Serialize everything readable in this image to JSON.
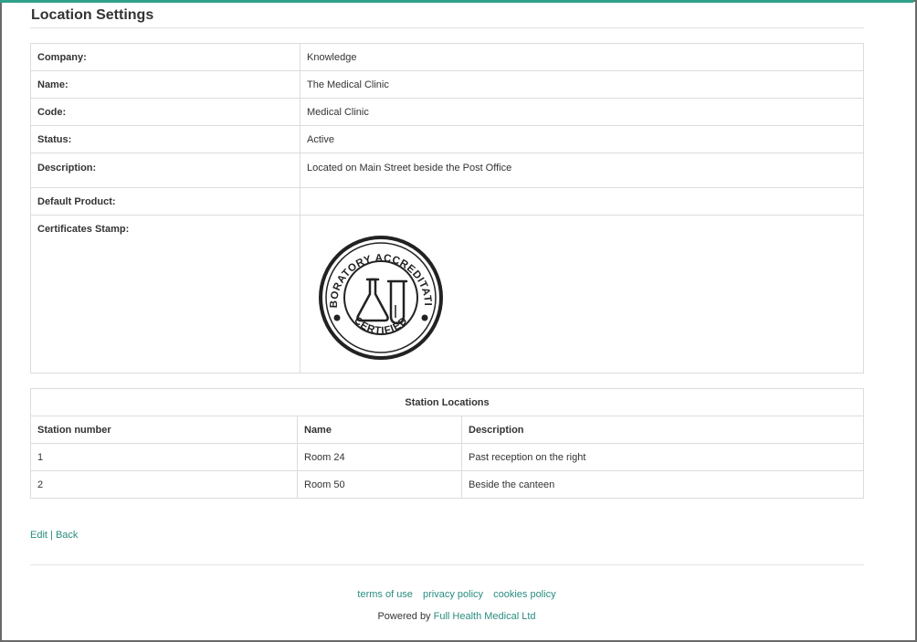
{
  "page": {
    "title": "Location Settings"
  },
  "details": {
    "company_label": "Company:",
    "company_value": "Knowledge",
    "name_label": "Name:",
    "name_value": "The Medical Clinic",
    "code_label": "Code:",
    "code_value": "Medical Clinic",
    "status_label": "Status:",
    "status_value": "Active",
    "description_label": "Description:",
    "description_value": "Located on Main Street beside the Post Office",
    "default_product_label": "Default Product:",
    "default_product_value": "",
    "certificates_stamp_label": "Certificates Stamp:",
    "stamp": {
      "top_text": "LABORATORY ACCREDITATION",
      "bottom_text": "CERTIFIED",
      "icon": "flask-and-test-tube-icon"
    }
  },
  "stations": {
    "caption": "Station Locations",
    "headers": [
      "Station number",
      "Name",
      "Description"
    ],
    "rows": [
      [
        "1",
        "Room 24",
        "Past reception on the right"
      ],
      [
        "2",
        "Room 50",
        "Beside the canteen"
      ]
    ]
  },
  "actions": {
    "edit_label": "Edit",
    "separator": "|",
    "back_label": "Back"
  },
  "footer": {
    "terms_label": "terms of use",
    "privacy_label": "privacy policy",
    "cookies_label": "cookies policy",
    "powered_prefix": "Powered by",
    "powered_link": "Full Health Medical Ltd"
  },
  "colors": {
    "accent": "#2a8c80",
    "top_bar": "#2fa08a",
    "frame_border": "#6a6a6a"
  }
}
